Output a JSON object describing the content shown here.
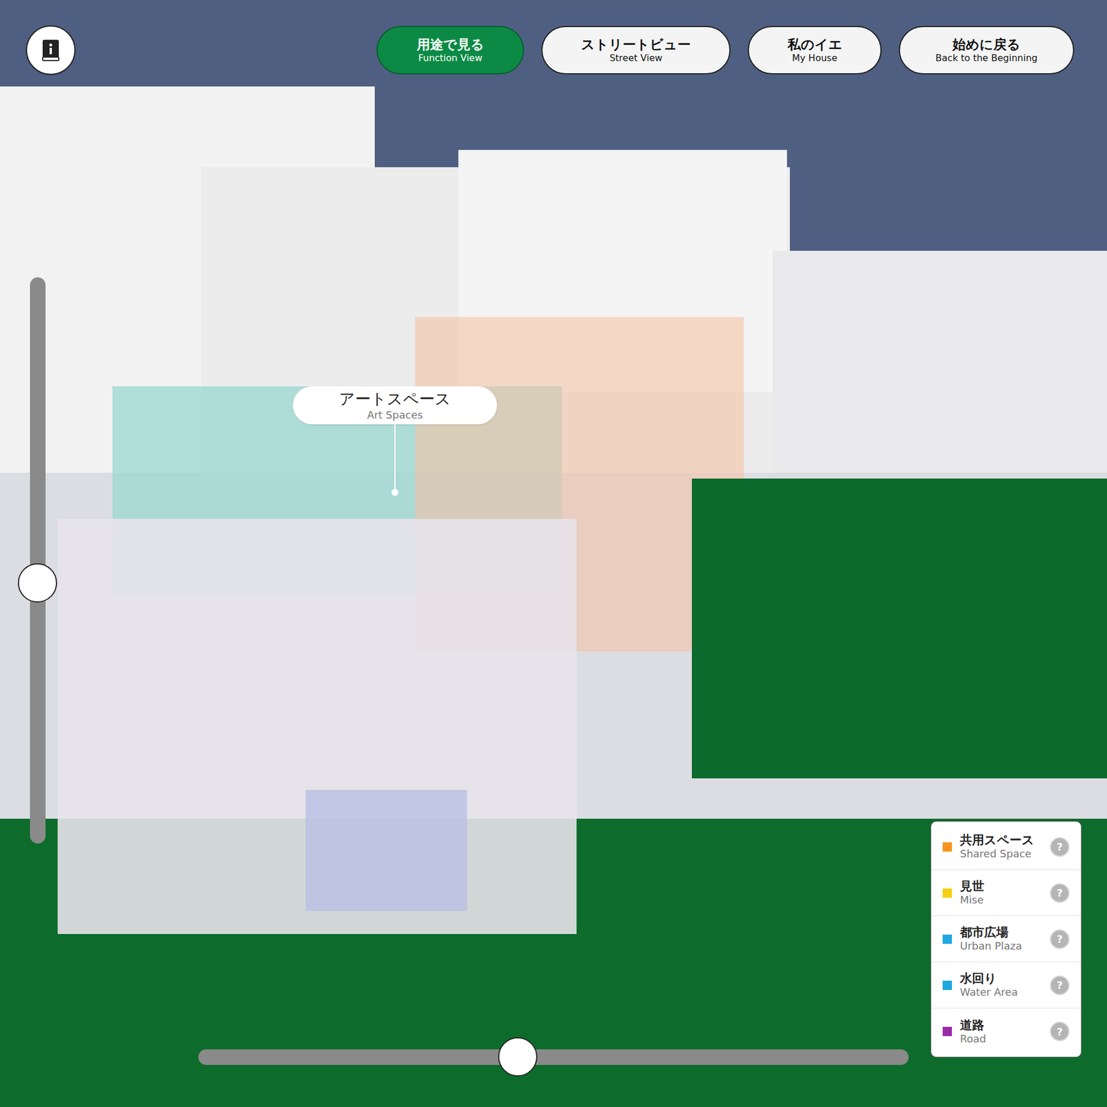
{
  "tabs": [
    {
      "label": "用途で見る",
      "sublabel": "Function View",
      "selected": true
    },
    {
      "label": "ストリートビュー",
      "sublabel": "Street View",
      "selected": false
    },
    {
      "label": "私のイエ",
      "sublabel": "My House",
      "selected": false
    },
    {
      "label": "始めに戻る",
      "sublabel": "Back to the Beginning",
      "selected": false
    }
  ],
  "callout": {
    "label": "アートスペース",
    "sublabel": "Art Spaces"
  },
  "sliders": {
    "vertical": {
      "level": 0.46
    },
    "horizontal": {
      "level": 0.45
    }
  },
  "legend": [
    {
      "label": "共用スペース",
      "sublabel": "Shared Space",
      "color": "#f5931e",
      "help": "?"
    },
    {
      "label": "見世",
      "sublabel": "Mise",
      "color": "#f5cf14",
      "help": "?"
    },
    {
      "label": "都市広場",
      "sublabel": "Urban Plaza",
      "color": "#1ea7e0",
      "help": "?"
    },
    {
      "label": "水回り",
      "sublabel": "Water Area",
      "color": "#1ea7e0",
      "help": "?"
    },
    {
      "label": "道路",
      "sublabel": "Road",
      "color": "#9b2aa8",
      "help": "?"
    }
  ]
}
